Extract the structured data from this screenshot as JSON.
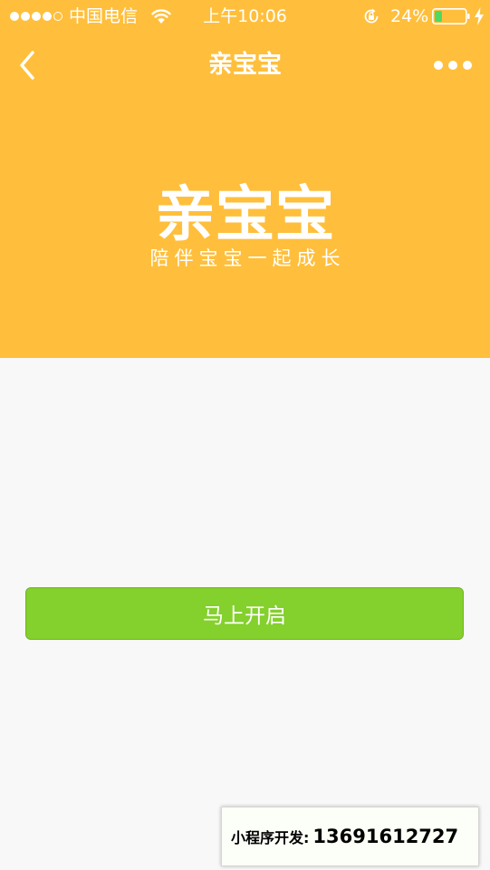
{
  "status_bar": {
    "carrier": "中国电信",
    "time": "上午10:06",
    "battery_percent": "24%",
    "battery_level": 0.24,
    "signal_bars_filled": 4,
    "signal_bars_total": 5
  },
  "nav": {
    "title": "亲宝宝",
    "back_icon": "chevron-left-icon",
    "more_icon": "more-dots-icon"
  },
  "logo": {
    "title": "亲宝宝",
    "slogan": "陪伴宝宝一起成长"
  },
  "main": {
    "start_button_label": "马上开启"
  },
  "watermark": {
    "label": "小程序开发:",
    "phone": "13691612727"
  },
  "colors": {
    "header_bg": "#ffbf3c",
    "page_bg": "#f8f8f8",
    "button_bg": "#84d02c",
    "battery_fill": "#4cd964"
  }
}
